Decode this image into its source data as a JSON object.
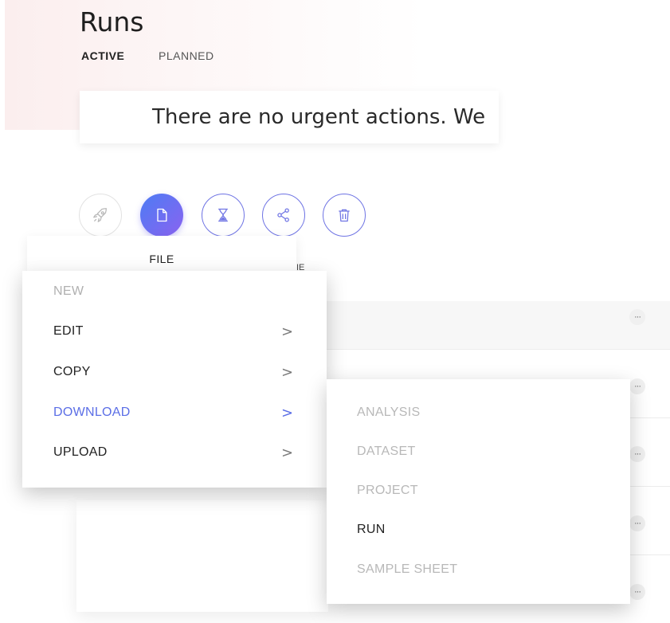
{
  "page": {
    "title": "Runs",
    "tabs": [
      {
        "label": "ACTIVE",
        "active": true
      },
      {
        "label": "PLANNED",
        "active": false
      }
    ]
  },
  "banner": {
    "text": "There are no urgent actions. We"
  },
  "actions": {
    "buttons": [
      {
        "icon": "rocket-icon",
        "state": "disabled"
      },
      {
        "icon": "file-icon",
        "state": "active"
      },
      {
        "icon": "hourglass-icon",
        "state": "enabled"
      },
      {
        "icon": "share-icon",
        "state": "enabled"
      },
      {
        "icon": "trash-icon",
        "state": "enabled"
      }
    ],
    "tooltip_label": "FILE",
    "clipped_label": "IE"
  },
  "file_menu": {
    "items": [
      {
        "label": "NEW",
        "state": "disabled",
        "has_submenu": false
      },
      {
        "label": "EDIT",
        "state": "enabled",
        "has_submenu": true
      },
      {
        "label": "COPY",
        "state": "enabled",
        "has_submenu": true
      },
      {
        "label": "DOWNLOAD",
        "state": "highlighted",
        "has_submenu": true
      },
      {
        "label": "UPLOAD",
        "state": "enabled",
        "has_submenu": true
      }
    ],
    "chevron": ">"
  },
  "download_submenu": {
    "items": [
      {
        "label": "ANALYSIS",
        "state": "disabled"
      },
      {
        "label": "DATASET",
        "state": "disabled"
      },
      {
        "label": "PROJECT",
        "state": "disabled"
      },
      {
        "label": "RUN",
        "state": "enabled"
      },
      {
        "label": "SAMPLE SHEET",
        "state": "disabled"
      }
    ]
  },
  "list": {
    "more_icon": "more-horizontal-icon",
    "more_glyph": "···"
  },
  "colors": {
    "accent": "#5b6ee6",
    "button_outline": "#6f74e4",
    "disabled_text": "#b0b0b0"
  }
}
